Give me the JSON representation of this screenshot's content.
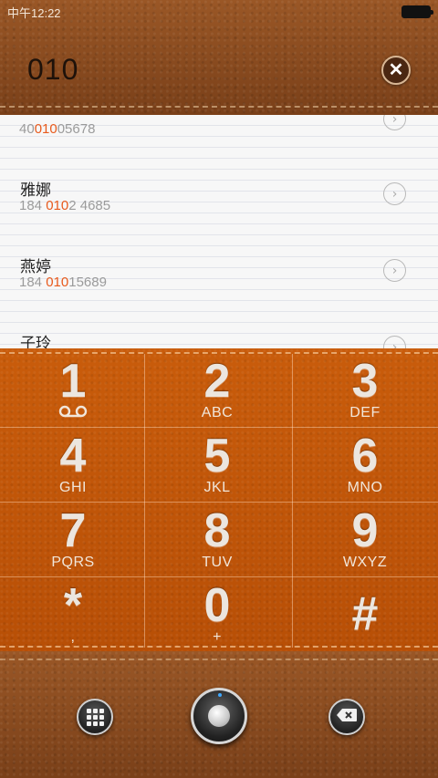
{
  "status_bar": {
    "time": "中午12:22"
  },
  "search": {
    "query": "010"
  },
  "contacts": [
    {
      "name": "",
      "number_pre": "40",
      "number_match": "010",
      "number_post": "05678"
    },
    {
      "name": "雅娜",
      "number_pre": "184 ",
      "number_match": "010",
      "number_post": "2 4685"
    },
    {
      "name": "燕婷",
      "number_pre": "184 ",
      "number_match": "010",
      "number_post": "15689"
    },
    {
      "name": "子玲",
      "number_pre": "",
      "number_match": "",
      "number_post": ""
    }
  ],
  "keypad": {
    "keys": [
      {
        "digit": "1",
        "letters": ""
      },
      {
        "digit": "2",
        "letters": "ABC"
      },
      {
        "digit": "3",
        "letters": "DEF"
      },
      {
        "digit": "4",
        "letters": "GHI"
      },
      {
        "digit": "5",
        "letters": "JKL"
      },
      {
        "digit": "6",
        "letters": "MNO"
      },
      {
        "digit": "7",
        "letters": "PQRS"
      },
      {
        "digit": "8",
        "letters": "TUV"
      },
      {
        "digit": "9",
        "letters": "WXYZ"
      },
      {
        "digit": "*",
        "letters": ","
      },
      {
        "digit": "0",
        "letters": "+"
      },
      {
        "digit": "#",
        "letters": ""
      }
    ]
  },
  "icons": {
    "clear": "close-icon",
    "keypad_toggle": "keypad-grid-icon",
    "call": "dial-knob-icon",
    "backspace": "backspace-icon",
    "voicemail": "voicemail-icon"
  },
  "colors": {
    "highlight": "#e85a1c",
    "keypad": "#c45708",
    "leather": "#8a4c1f"
  }
}
